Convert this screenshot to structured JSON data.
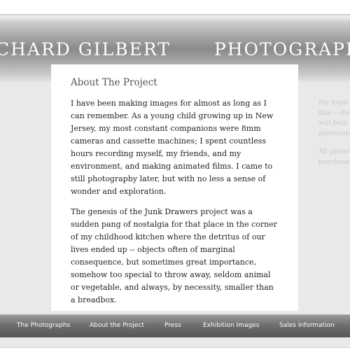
{
  "header": {
    "title_left": "CHARD GILBERT",
    "title_right": "PHOTOGRAPH"
  },
  "main": {
    "heading": "About The Project",
    "paragraphs": [
      "I have been making images for almost as long as I can remember. As a young child growing up in New Jersey, my most constant companions were 8mm cameras and cassette machines; I spent countless hours recording myself, my friends, and my environment, and making animated films. I came to still photography later, but with no less a sense of wonder and exploration.",
      "The genesis of the Junk Drawers project was a sudden pang of nostalgia for that place in the corner of my childhood kitchen where the detritus of our lives ended up -- objects often of marginal consequence, but sometimes great importance, somehow too special to throw away, seldom animal or vegetable, and always, by necessity, smaller than a breadbox."
    ]
  },
  "sidebar": {
    "block1": [
      "My hope",
      "film -- the",
      "will help",
      "ephemera"
    ],
    "block2": [
      "All pieces",
      "purchase"
    ]
  },
  "nav": {
    "items": [
      "The Photographs",
      "About the Project",
      "Press",
      "Exhibition Images",
      "Sales Information"
    ]
  }
}
